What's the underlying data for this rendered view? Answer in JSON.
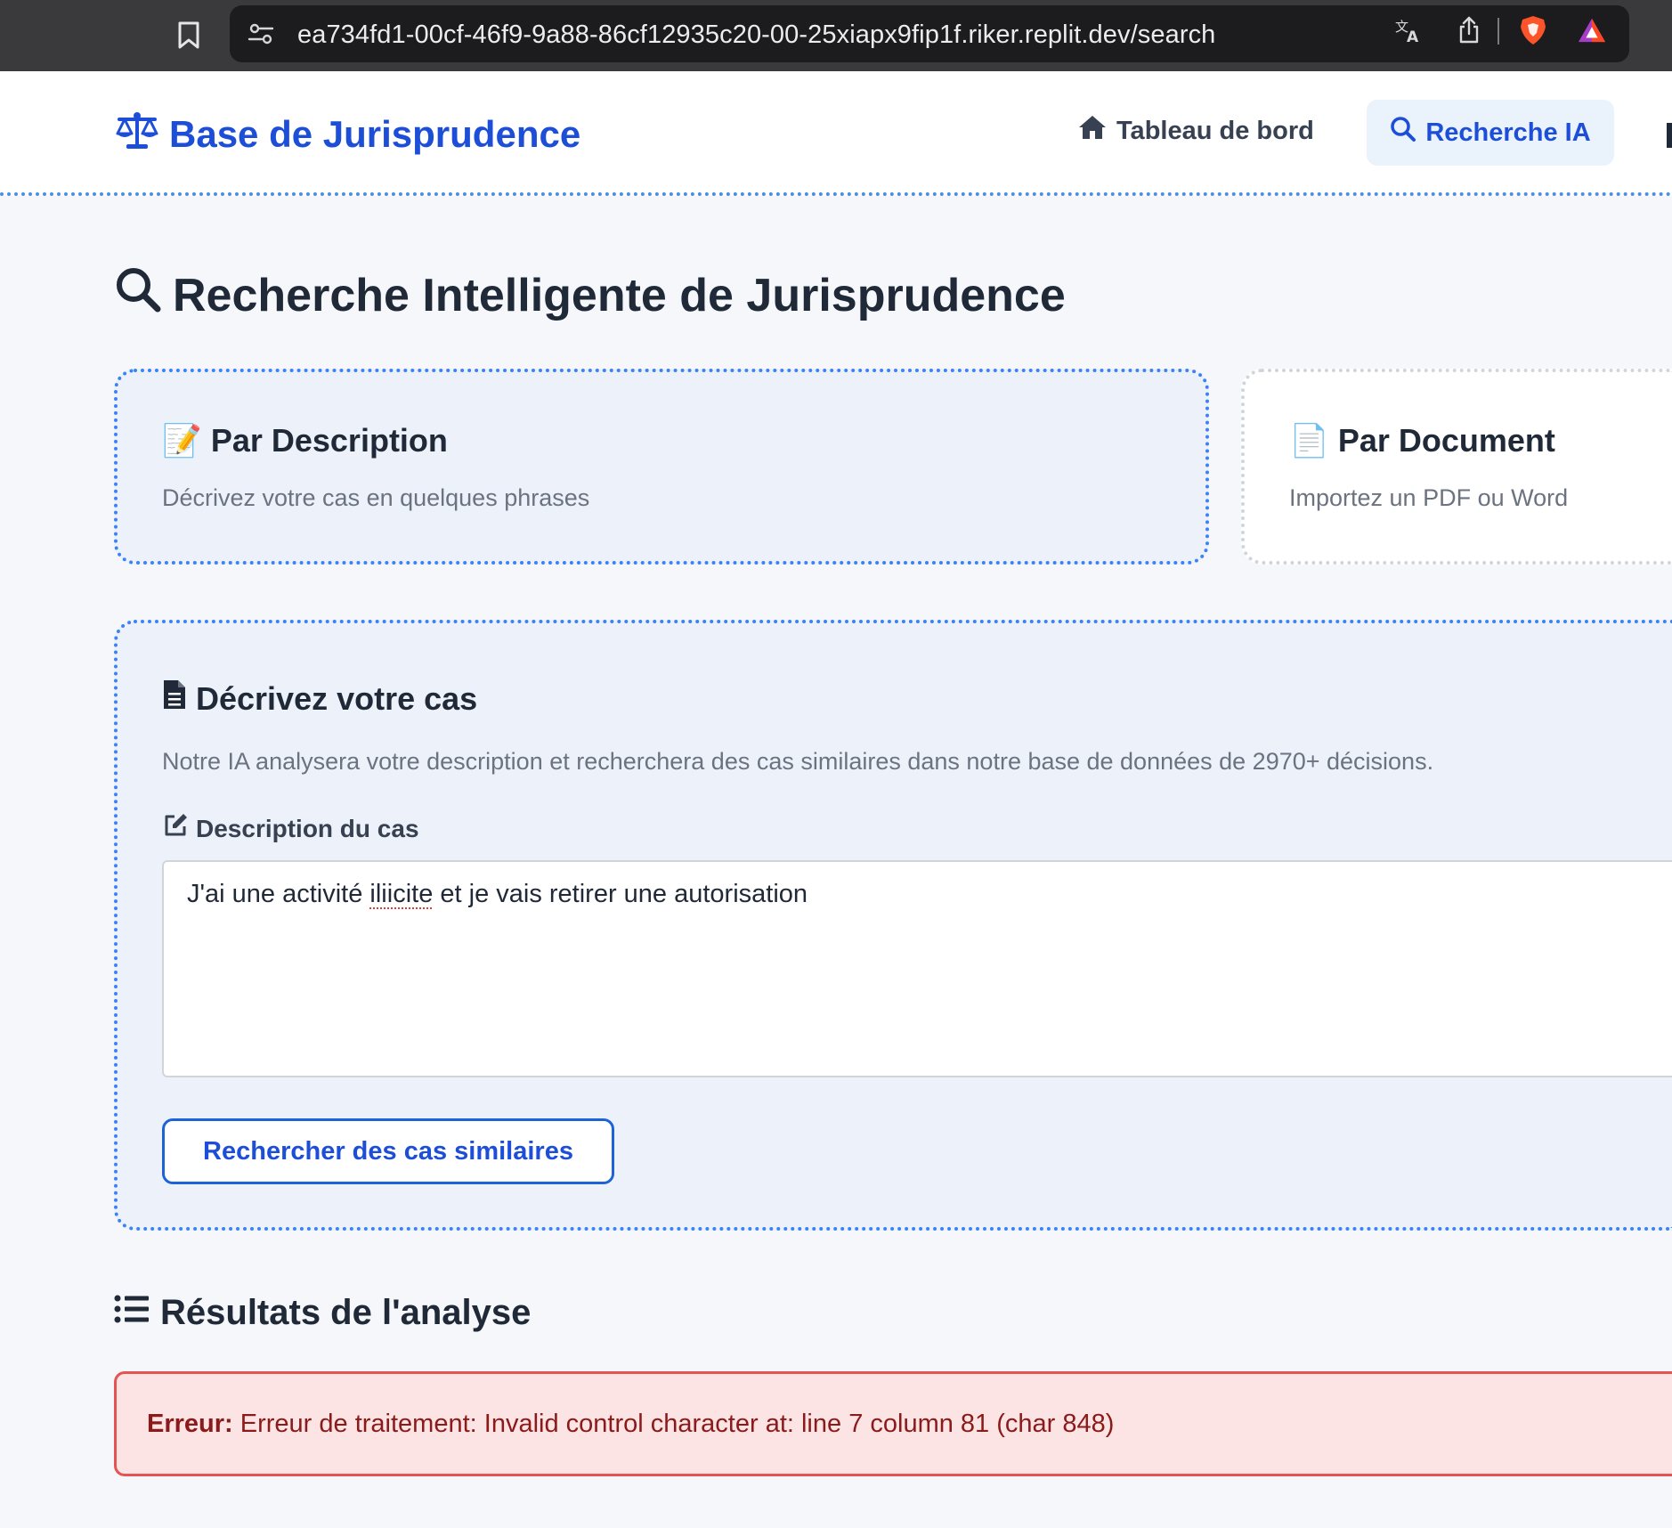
{
  "browser": {
    "url": "ea734fd1-00cf-46f9-9a88-86cf12935c20-00-25xiapx9fip1f.riker.replit.dev/search",
    "icons": [
      "bookmark-icon",
      "site-settings-icon",
      "translate-icon",
      "share-icon",
      "brave-shield-icon",
      "brave-rewards-icon"
    ]
  },
  "navbar": {
    "brand": "Base de Jurisprudence",
    "brand_icon": "scale-balance-icon",
    "links": {
      "dashboard": "Tableau de bord",
      "search": "Recherche IA"
    },
    "active_link": "search"
  },
  "page": {
    "title": "Recherche Intelligente de Jurisprudence"
  },
  "modes": {
    "description": {
      "emoji": "📝",
      "title": "Par Description",
      "subtitle": "Décrivez votre cas en quelques phrases"
    },
    "document": {
      "emoji": "📄",
      "title": "Par Document",
      "subtitle": "Importez un PDF ou Word"
    }
  },
  "form": {
    "title": "Décrivez votre cas",
    "intro": "Notre IA analysera votre description et recherchera des cas similaires dans notre base de données de 2970+ décisions.",
    "field_label": "Description du cas",
    "textarea_value": {
      "before": "J'ai une activité ",
      "misspelled": "iliicite",
      "after": " et je vais retirer une autorisation"
    },
    "submit_label": "Rechercher des cas similaires"
  },
  "results": {
    "title": "Résultats de l'analyse",
    "error_label": "Erreur:",
    "error_message": "Erreur de traitement: Invalid control character at: line 7 column 81 (char 848)"
  },
  "colors": {
    "brand": "#1d4ed8",
    "active_nav_bg": "#eaf2fc",
    "focus_border": "#3b82f6",
    "error_bg": "#fde4e4",
    "error_border": "#e55353",
    "error_text": "#8b1a1a"
  }
}
